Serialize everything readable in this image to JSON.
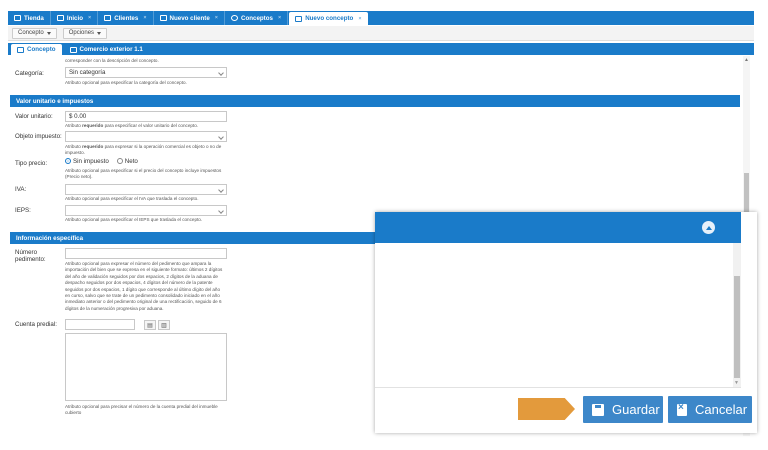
{
  "topbar": {
    "tabs": [
      {
        "label": "Tienda"
      },
      {
        "label": "Inicio"
      },
      {
        "label": "Clientes"
      },
      {
        "label": "Nuevo cliente"
      },
      {
        "label": "Conceptos"
      },
      {
        "label": "Nuevo concepto"
      }
    ],
    "close_glyph": "×"
  },
  "toolbar": {
    "concepto_label": "Concepto",
    "opciones_label": "Opciones"
  },
  "inner_tabs": [
    {
      "label": "Concepto"
    },
    {
      "label": "Comercio exterior 1.1"
    }
  ],
  "form": {
    "top_help": "corresponder con la descripción del concepto.",
    "categoria": {
      "label": "Categoría:",
      "value": "Sin categoría",
      "help": "Atributo opcional para especificar la categoría del concepto."
    },
    "section_valor": "Valor unitario e impuestos",
    "valor_unitario": {
      "label": "Valor unitario:",
      "value": "$ 0.00",
      "help_pre": "Atributo ",
      "help_strong": "requerido",
      "help_post": " para especificar el valor unitario del concepto."
    },
    "objeto_impuesto": {
      "label": "Objeto impuesto:",
      "value": "",
      "help_pre": "Atributo ",
      "help_strong": "requerido",
      "help_post": " para expresar si la operación comercial es objeto o no de impuesto."
    },
    "tipo_precio": {
      "label": "Tipo precio:",
      "option1": "Sin impuesto",
      "option2": "Neto",
      "help": "Atributo opcional para especificar si el precio del concepto incluye impuestos (Precio neto)."
    },
    "iva": {
      "label": "IVA:",
      "value": "",
      "help": "Atributo opcional para especificar el IVA que traslada el concepto."
    },
    "ieps": {
      "label": "IEPS:",
      "value": "",
      "help": "Atributo opcional para especificar el IEPS que traslada el concepto."
    },
    "section_info": "Información específica",
    "numero_pedimento": {
      "label_line1": "Número",
      "label_line2": "pedimento:",
      "value": "",
      "help": "Atributo opcional para expresar el número del pedimento que ampara la importación del bien que se expresa en el siguiente formato: últimos 2 dígitos del año de validación seguidos por dos espacios, 2 dígitos de la aduana de despacho seguidos por dos espacios, 4 dígitos del número de la patente seguidos por dos espacios, 1 dígito que corresponde al último dígito del año en curso, salvo que se trate de un pedimento consolidado iniciado en el año inmediato anterior o del pedimento original de una rectificación, seguido de 6 dígitos de la numeración progresiva por aduana."
    },
    "cuenta_predial": {
      "label": "Cuenta predial:",
      "value": "",
      "help": "Atributo opcional para precisar el número de la cuenta predial del inmueble cubierto"
    }
  },
  "popup": {
    "save_label": "Guardar",
    "cancel_label": "Cancelar"
  },
  "colors": {
    "primary": "#1a7bc9",
    "button": "#3d87c9",
    "arrow": "#e39a3c"
  }
}
